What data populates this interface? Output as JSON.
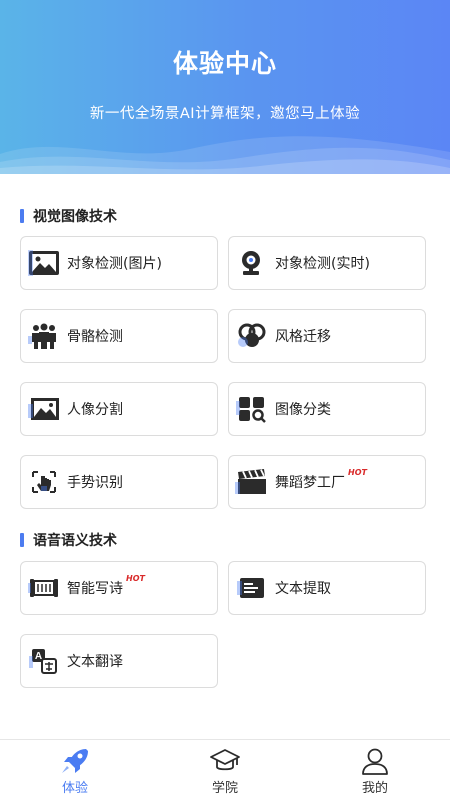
{
  "header": {
    "title": "体验中心",
    "subtitle": "新一代全场景AI计算框架，邀您马上体验"
  },
  "vision": {
    "section_title": "视觉图像技术",
    "items": [
      {
        "label": "对象检测(图片)",
        "icon": "image-icon"
      },
      {
        "label": "对象检测(实时)",
        "icon": "webcam-icon"
      },
      {
        "label": "骨骼检测",
        "icon": "people-group-icon"
      },
      {
        "label": "风格迁移",
        "icon": "style-circles-icon"
      },
      {
        "label": "人像分割",
        "icon": "portrait-image-icon"
      },
      {
        "label": "图像分类",
        "icon": "grid-search-icon"
      },
      {
        "label": "手势识别",
        "icon": "hand-gesture-icon"
      },
      {
        "label": "舞蹈梦工厂",
        "icon": "clapperboard-icon",
        "badge": "HOT"
      }
    ]
  },
  "speech": {
    "section_title": "语音语义技术",
    "items": [
      {
        "label": "智能写诗",
        "icon": "poem-scroll-icon",
        "badge": "HOT"
      },
      {
        "label": "文本提取",
        "icon": "text-document-icon"
      },
      {
        "label": "文本翻译",
        "icon": "translate-icon"
      }
    ]
  },
  "tabbar": {
    "items": [
      {
        "label": "体验",
        "icon": "rocket-icon",
        "active": true
      },
      {
        "label": "学院",
        "icon": "graduation-cap-icon"
      },
      {
        "label": "我的",
        "icon": "user-icon"
      }
    ],
    "accent": "#4a7cf2"
  },
  "colors": {
    "header_gradient_start": "#5ab4e8",
    "header_gradient_end": "#5b86f5",
    "section_bar": "#4c7cf0",
    "hot_badge": "#d92a2a"
  }
}
